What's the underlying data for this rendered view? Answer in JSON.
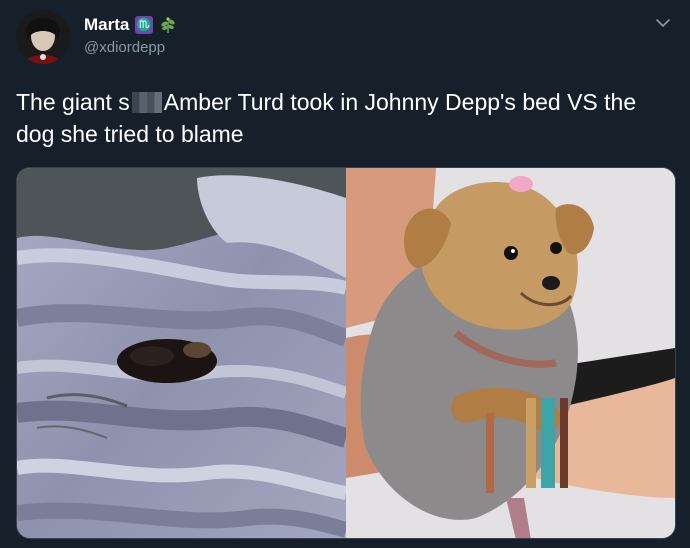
{
  "author": {
    "display_name": "Marta",
    "badge_glyph": "♏",
    "handle": "@xdiordepp"
  },
  "tweet": {
    "text_part1": "The giant s",
    "text_part2": "Amber Turd took in Johnny Depp's bed VS the dog she tried to blame"
  },
  "icons": {
    "badge": "scorpio-zodiac-icon",
    "plant": "herb-icon",
    "menu": "chevron-down-icon"
  },
  "colors": {
    "background": "#15202b",
    "secondary_text": "#8899a6",
    "badge": "#7b3fb3"
  }
}
